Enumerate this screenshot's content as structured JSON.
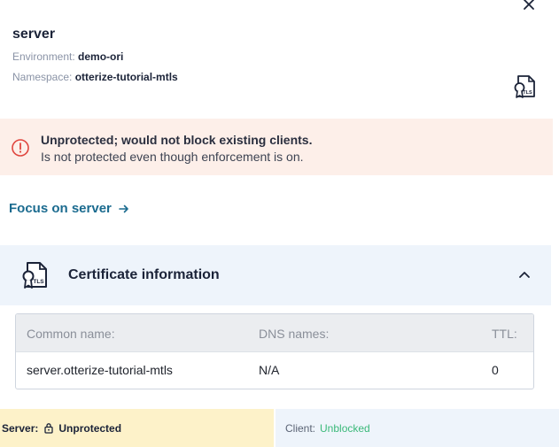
{
  "panel": {
    "title": "server",
    "environment_label": "Environment:",
    "environment_value": "demo-ori",
    "namespace_label": "Namespace:",
    "namespace_value": "otterize-tutorial-mtls",
    "close_icon": "close-icon",
    "badge_icon": "tls-certificate-icon"
  },
  "alert": {
    "icon": "alert-circle-icon",
    "title": "Unprotected; would not block existing clients.",
    "description": "Is not protected even though enforcement is on.",
    "color": "#fdefe9"
  },
  "focus_link": {
    "label": "Focus on server",
    "icon": "arrow-right-icon",
    "color": "#1b6b8f"
  },
  "certificate": {
    "title": "Certificate information",
    "icon": "tls-certificate-icon",
    "expanded": true,
    "columns": [
      "Common name:",
      "DNS names:",
      "TTL:"
    ],
    "rows": [
      [
        "server.otterize-tutorial-mtls",
        "N/A",
        "0"
      ]
    ]
  },
  "status_bar": {
    "server_label": "Server:",
    "server_value": "Unprotected",
    "server_icon": "lock-icon",
    "server_bg": "#fdf2c9",
    "client_label": "Client:",
    "client_value": "Unblocked",
    "client_value_color": "#3bb97a"
  }
}
